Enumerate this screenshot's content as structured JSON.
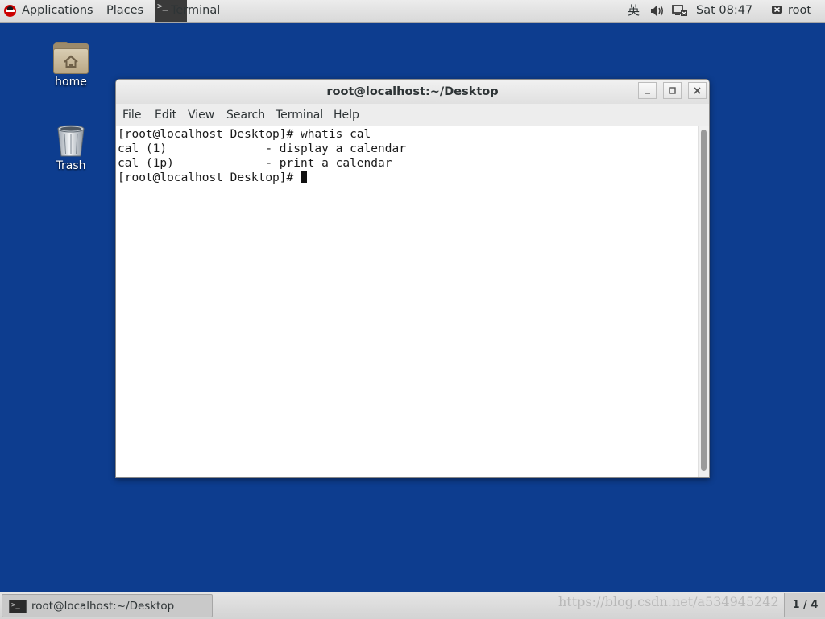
{
  "top_bar": {
    "applications_label": "Applications",
    "places_label": "Places",
    "active_app_label": "Terminal",
    "input_method": "英",
    "clock": "Sat 08:47",
    "user_name": "root"
  },
  "desktop_icons": [
    {
      "label": "home",
      "icon": "home-folder-icon"
    },
    {
      "label": "Trash",
      "icon": "trash-icon"
    }
  ],
  "terminal_window": {
    "title": "root@localhost:~/Desktop",
    "menu": [
      "File",
      "Edit",
      "View",
      "Search",
      "Terminal",
      "Help"
    ],
    "lines": [
      "[root@localhost Desktop]# whatis cal",
      "cal (1)              - display a calendar",
      "cal (1p)             - print a calendar",
      "[root@localhost Desktop]# "
    ]
  },
  "taskbar": {
    "window_label": "root@localhost:~/Desktop",
    "watermark": "https://blog.csdn.net/a534945242",
    "workspace": "1 / 4"
  },
  "colors": {
    "desktop_bg": "#0d3d8f",
    "panel_bg": "#dedede"
  }
}
